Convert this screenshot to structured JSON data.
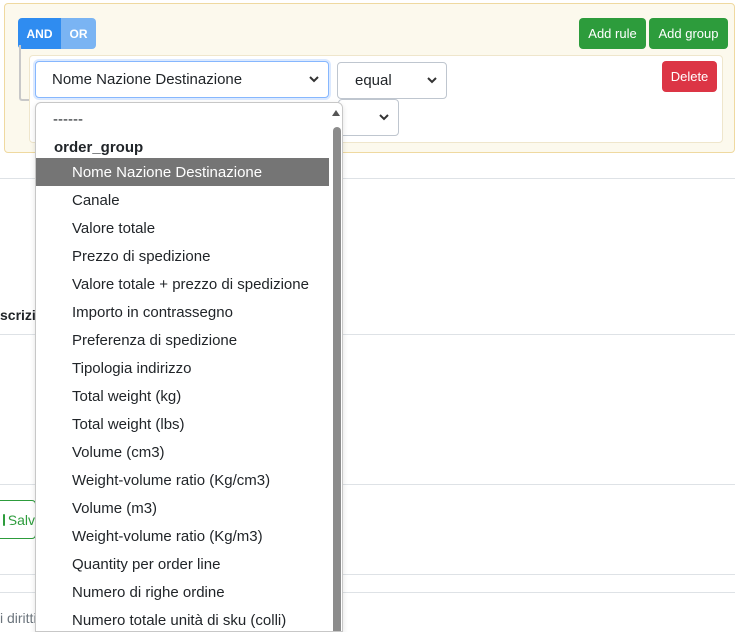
{
  "builder": {
    "conditions": [
      "AND",
      "OR"
    ],
    "add_rule": "Add rule",
    "add_group": "Add group",
    "rule": {
      "field_value": "Nome Nazione Destinazione",
      "operator_value": "equal",
      "delete": "Delete"
    }
  },
  "background": {
    "desc_fragment": "scrizi",
    "save_fragment": "Salv",
    "rights_fragment": "i diritti"
  },
  "dropdown": {
    "placeholder": "------",
    "group_label": "order_group",
    "selected": "Nome Nazione Destinazione",
    "options": [
      "Nome Nazione Destinazione",
      "Canale",
      "Valore totale",
      "Prezzo di spedizione",
      "Valore totale + prezzo di spedizione",
      "Importo in contrassegno",
      "Preferenza di spedizione",
      "Tipologia indirizzo",
      "Total weight (kg)",
      "Total weight (lbs)",
      "Volume (cm3)",
      "Weight-volume ratio (Kg/cm3)",
      "Volume (m3)",
      "Weight-volume ratio (Kg/m3)",
      "Quantity per order line",
      "Numero di righe ordine",
      "Numero totale unità di sku (colli)"
    ]
  },
  "colors": {
    "and_active": "#2f8cf0",
    "or_inactive": "#7ab4f3",
    "success": "#2d9c3c",
    "danger": "#dc3545",
    "group_bg": "#fcf9ed",
    "selected_option": "#757575"
  },
  "icons": {
    "select_chevron": "chevron-down-icon",
    "save": "floppy-icon",
    "scroll_up": "triangle-up-icon"
  }
}
